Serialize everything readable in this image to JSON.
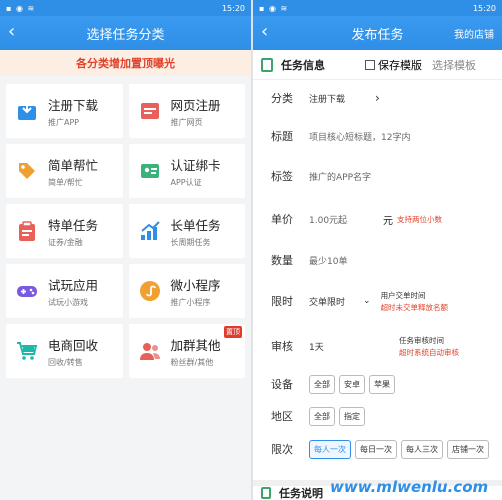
{
  "left": {
    "status": {
      "time": "15:20"
    },
    "title": "选择任务分类",
    "banner": "各分类增加置顶曝光",
    "cards": [
      {
        "title": "注册下载",
        "sub": "推广APP",
        "icon": "download-icon",
        "color": "#2f8fe6"
      },
      {
        "title": "网页注册",
        "sub": "推广网页",
        "icon": "webpage-icon",
        "color": "#e8605a"
      },
      {
        "title": "简单帮忙",
        "sub": "简单/帮忙",
        "icon": "tag-icon",
        "color": "#f0a030"
      },
      {
        "title": "认证绑卡",
        "sub": "APP认证",
        "icon": "id-card-icon",
        "color": "#3bb27a"
      },
      {
        "title": "特单任务",
        "sub": "证券/金融",
        "icon": "clipboard-icon",
        "color": "#e8605a"
      },
      {
        "title": "长单任务",
        "sub": "长周期任务",
        "icon": "trend-chart-icon",
        "color": "#2f8fe6"
      },
      {
        "title": "试玩应用",
        "sub": "试玩小游戏",
        "icon": "gamepad-icon",
        "color": "#7a5ae0"
      },
      {
        "title": "微小程序",
        "sub": "推广小程序",
        "icon": "mini-program-icon",
        "color": "#f0a030"
      },
      {
        "title": "电商回收",
        "sub": "回收/转售",
        "icon": "cart-icon",
        "color": "#1fb8a8"
      },
      {
        "title": "加群其他",
        "sub": "粉丝群/其他",
        "icon": "group-icon",
        "color": "#e8605a",
        "badge": "置顶"
      }
    ]
  },
  "right": {
    "status": {
      "time": "15:20"
    },
    "title": "发布任务",
    "right_link": "我的店铺",
    "section_title": "任务信息",
    "save_template": "保存模版",
    "choose_template": "选择模板",
    "fields": {
      "category": {
        "label": "分类",
        "value": "注册下载"
      },
      "headline": {
        "label": "标题",
        "placeholder": "项目核心短标题，12字内"
      },
      "tag": {
        "label": "标签",
        "placeholder": "推广的APP名字"
      },
      "price": {
        "label": "单价",
        "placeholder": "1.00元起",
        "unit": "元",
        "note": "支持两位小数"
      },
      "quantity": {
        "label": "数量",
        "placeholder": "最少10单"
      },
      "time_limit": {
        "label": "限时",
        "value": "交单限时",
        "hint": "用户交单时间",
        "note": "超时未交单释放名额"
      },
      "review": {
        "label": "审核",
        "value": "1天",
        "hint": "任务审核时间",
        "note": "超时系统自动审核"
      },
      "device": {
        "label": "设备",
        "options": [
          "全部",
          "安卓",
          "苹果"
        ]
      },
      "region": {
        "label": "地区",
        "options": [
          "全部",
          "指定"
        ]
      },
      "frequency": {
        "label": "限次",
        "options": [
          "每人一次",
          "每日一次",
          "每人三次",
          "店铺一次"
        ]
      }
    },
    "footer_section": "任务说明",
    "watermark": "www.mlwenlu.com"
  }
}
